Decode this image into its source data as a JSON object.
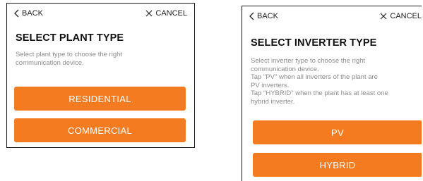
{
  "left_screen": {
    "nav": {
      "back_label": "BACK",
      "cancel_label": "CANCEL"
    },
    "title": "SELECT PLANT TYPE",
    "description_lines": [
      "Select plant type to choose the right",
      "communication device."
    ],
    "buttons": [
      "RESIDENTIAL",
      "COMMERCIAL"
    ]
  },
  "right_screen": {
    "nav": {
      "back_label": "BACK",
      "cancel_label": "CANCEL"
    },
    "title": "SELECT INVERTER TYPE",
    "description_lines": [
      "Select inverter type to choose the right",
      "communication device.",
      "Tap \"PV\" when all inverters of the plant are",
      "PV inverters.",
      "Tap \"HYBRID\" when the plant has at least one",
      "hybrid inverter."
    ],
    "buttons": [
      "PV",
      "HYBRID"
    ]
  },
  "colors": {
    "button_background": "#f47b20",
    "button_text": "#ffffff",
    "description_text": "#8c8c8c"
  },
  "icons": {
    "back": "chevron-left-icon",
    "cancel": "close-icon"
  }
}
